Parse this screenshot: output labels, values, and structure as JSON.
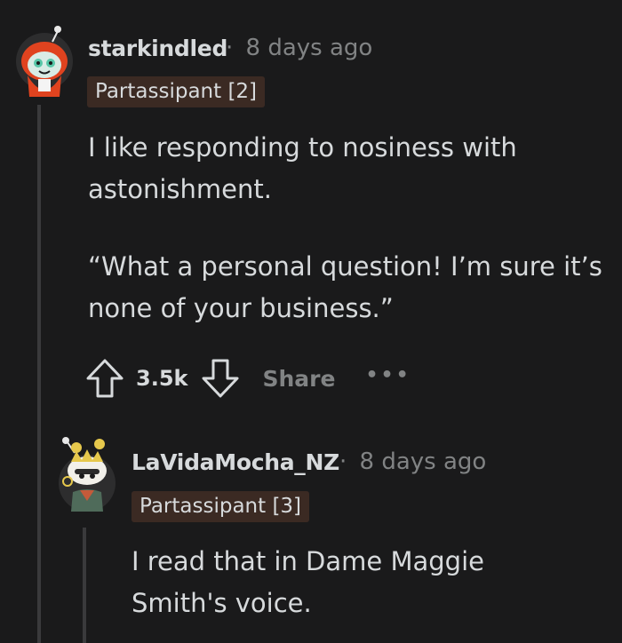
{
  "comments": [
    {
      "username": "starkindled",
      "separator": "·",
      "age": "8 days ago",
      "flair": "Partassipant [2]",
      "paragraphs": [
        "I like responding to nosiness with astonishment.",
        "“What a personal question! I’m sure it’s none of your business.”"
      ],
      "avatar_icon": "snoo-avatar-red-hood-icon",
      "score": "3.5k",
      "share_label": "Share",
      "more_label": "•••"
    },
    {
      "username": "LaVidaMocha_NZ",
      "separator": "·",
      "age": "8 days ago",
      "flair": "Partassipant [3]",
      "paragraphs": [
        "I read that in Dame Maggie Smith's voice."
      ],
      "avatar_icon": "snoo-avatar-crown-icon"
    }
  ],
  "colors": {
    "background": "#1a1a1b",
    "text": "#d7dadc",
    "muted": "#818384",
    "flair_bg": "#3b2a23",
    "thread_line": "#3a3a3c"
  }
}
